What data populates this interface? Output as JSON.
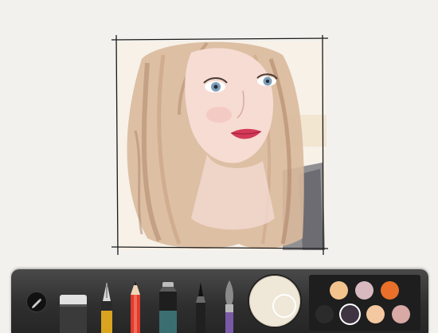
{
  "app": {
    "accent": "#e8702a",
    "toolbar_color": "#2f2f2f",
    "canvas_color": "#f3f1ed"
  },
  "artwork": {
    "subject_icon": "portrait-sketch",
    "frame_color": "#1a1a1a"
  },
  "toolbar": {
    "tools": [
      {
        "name": "pencil-badge-icon"
      },
      {
        "name": "eraser-icon"
      },
      {
        "name": "fountain-pen-icon"
      },
      {
        "name": "pencil-icon"
      },
      {
        "name": "marker-icon"
      },
      {
        "name": "outline-pen-icon"
      },
      {
        "name": "brush-icon"
      }
    ],
    "mixer": {
      "selected_color": "#efe7d7"
    },
    "palette": [
      "#f3c48d",
      "#d9b9c0",
      "#e8702a",
      "#2b2b2b",
      "#3f3542",
      "#f4c8a0",
      "#d8a9a5"
    ],
    "selected_swatch": "#3f3542"
  }
}
